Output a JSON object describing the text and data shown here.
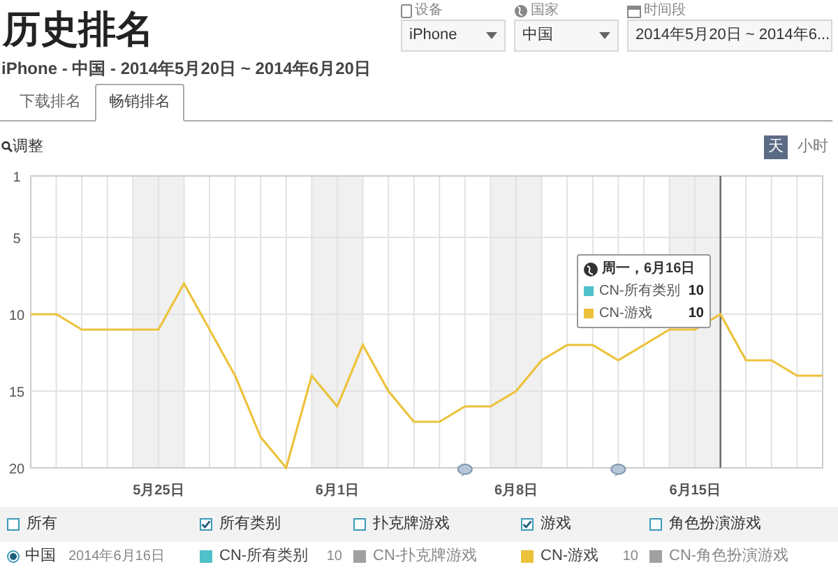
{
  "title": "历史排名",
  "filters": [
    {
      "kind": "device",
      "label": "设备",
      "value": "iPhone"
    },
    {
      "kind": "country",
      "label": "国家",
      "value": "中国"
    },
    {
      "kind": "period",
      "label": "时间段",
      "value": "2014年5月20日 ~ 2014年6..."
    }
  ],
  "subtitle": "iPhone - 中国 - 2014年5月20日 ~ 2014年6月20日",
  "tabs": [
    {
      "label": "下载排名",
      "selected": false
    },
    {
      "label": "畅销排名",
      "selected": true
    }
  ],
  "zoom_label": "调整",
  "granularity": [
    {
      "label": "天",
      "selected": true
    },
    {
      "label": "小时",
      "selected": false
    }
  ],
  "chart_data": {
    "type": "line",
    "categories": [
      null,
      null,
      null,
      null,
      null,
      "5月25日",
      null,
      null,
      null,
      null,
      null,
      null,
      "6月1日",
      null,
      null,
      null,
      null,
      null,
      null,
      "6月8日",
      null,
      null,
      null,
      null,
      null,
      null,
      "6月15日",
      null,
      null,
      null,
      null,
      null
    ],
    "series": [
      {
        "color": "#ecc23a",
        "values": [
          10,
          10,
          11,
          11,
          11,
          11,
          8,
          11,
          14,
          18,
          20,
          14,
          16,
          12,
          15,
          17,
          17,
          16,
          16,
          15,
          13,
          12,
          12,
          13,
          12,
          11,
          11,
          10,
          13,
          13,
          14,
          14
        ]
      }
    ],
    "ylim": [
      20,
      1
    ],
    "yticks": [
      1,
      5,
      10,
      15,
      20
    ],
    "grid": true
  },
  "tooltip": {
    "title": "周一，6月16日",
    "rows": [
      {
        "name": "CN-所有类别",
        "value": "10",
        "color": "#4fc1c9"
      },
      {
        "name": "CN-游戏",
        "value": "10",
        "color": "#ecc23a"
      }
    ]
  },
  "legend_filters": [
    {
      "label": "所有",
      "checked": false
    },
    {
      "label": "所有类别",
      "checked": true
    },
    {
      "label": "扑克牌游戏",
      "checked": false
    },
    {
      "label": "游戏",
      "checked": true
    },
    {
      "label": "角色扮演游戏",
      "checked": false
    }
  ],
  "legend_values": {
    "region": {
      "label": "中国",
      "selected": true
    },
    "date": "2014年6月16日",
    "items": [
      {
        "name": "CN-所有类别",
        "color": "#4fc1c9",
        "value": "10"
      },
      {
        "name": "CN-扑克牌游戏",
        "color": "#a0a0a0"
      },
      {
        "name": "CN-游戏",
        "color": "#ecc23a",
        "value": "10"
      },
      {
        "name": "CN-角色扮演游戏",
        "color": "#a0a0a0"
      }
    ]
  }
}
